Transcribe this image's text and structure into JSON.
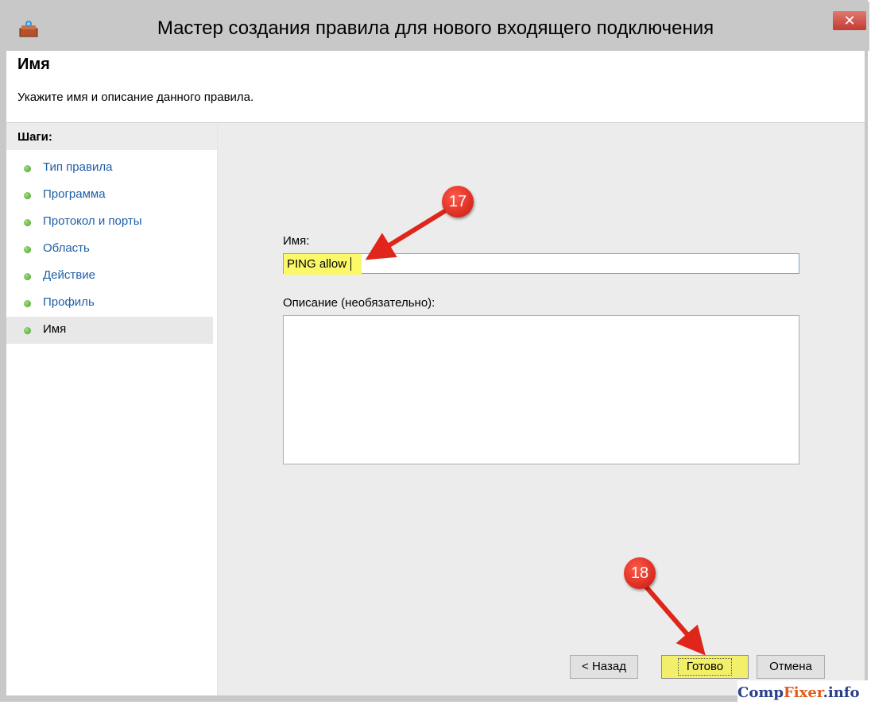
{
  "window": {
    "title": "Мастер создания правила для нового входящего подключения",
    "close_glyph": "✕",
    "icon": "firewall-wizard-icon"
  },
  "header": {
    "title": "Имя",
    "subtitle": "Укажите имя и описание данного правила."
  },
  "steps": {
    "title": "Шаги:",
    "items": [
      {
        "label": "Тип правила"
      },
      {
        "label": "Программа"
      },
      {
        "label": "Протокол и порты"
      },
      {
        "label": "Область"
      },
      {
        "label": "Действие"
      },
      {
        "label": "Профиль"
      },
      {
        "label": "Имя",
        "active": true
      }
    ]
  },
  "form": {
    "name_label": "Имя:",
    "name_value": "PING allow",
    "description_label": "Описание (необязательно):",
    "description_value": ""
  },
  "buttons": {
    "back": "< Назад",
    "finish": "Готово",
    "cancel": "Отмена"
  },
  "annotations": {
    "badge_17": "17",
    "badge_18": "18",
    "color": "#e0261b",
    "highlight_color": "#fbf96a"
  },
  "watermark": {
    "part1": "Comp",
    "part2": "Fixer",
    "part3": ".info"
  }
}
